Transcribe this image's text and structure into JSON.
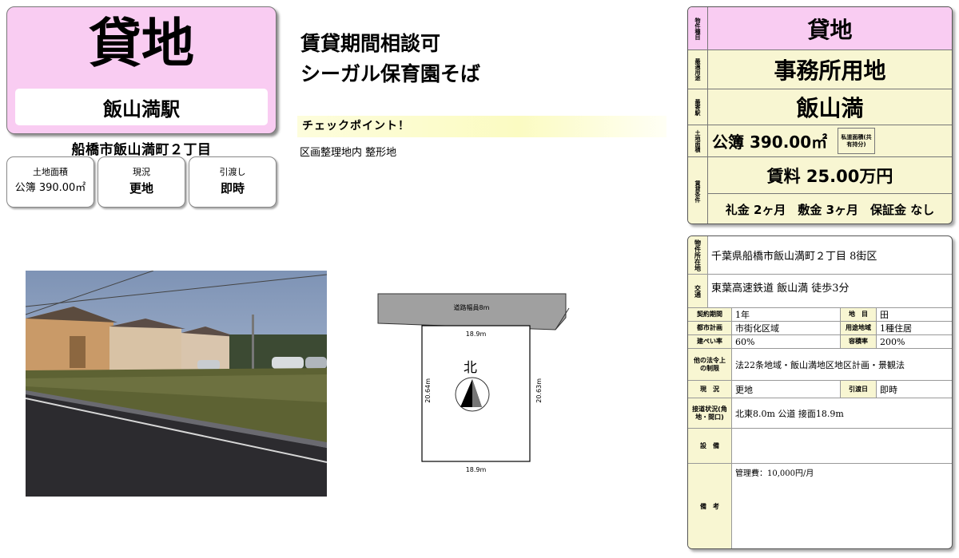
{
  "header": {
    "title": "貸地",
    "station": "飯山満駅",
    "address": "船橋市飯山満町２丁目"
  },
  "info_boxes": [
    {
      "label": "土地面積",
      "value": "公簿 390.00㎡"
    },
    {
      "label": "現況",
      "value": "更地"
    },
    {
      "label": "引渡し",
      "value": "即時"
    }
  ],
  "catchcopy": {
    "line1": "賃貸期間相談可",
    "line2": "シーガル保育園そば"
  },
  "checkpoint": {
    "heading": "チェックポイント！",
    "text": "区画整理地内 整形地"
  },
  "plan": {
    "road_label": "道路幅員8m",
    "top_width": "18.9m",
    "bottom_width": "18.9m",
    "left_depth": "20.64m",
    "right_depth": "20.63m",
    "north_label": "北"
  },
  "summary": {
    "type_label": "物件種目",
    "type_value": "貸地",
    "use_label": "最適用途",
    "use_value": "事務所用地",
    "station_label": "最寄駅",
    "station_value": "飯山満",
    "area_label": "土地面積",
    "area_value": "公簿 390.00㎡",
    "private_road_label": "私道面積(共有持分)",
    "rent_label": "賃貸条件",
    "rent_value": "賃料 25.00万円",
    "conditions": "礼金 2ヶ月　敷金 3ヶ月　保証金 なし"
  },
  "detail": {
    "location_label": "物件所在地",
    "location_value": "千葉県船橋市飯山満町２丁目 8街区",
    "traffic_label": "交通",
    "traffic_value": "東葉高速鉄道 飯山満 徒歩3分",
    "contract_label": "契約期間",
    "contract_value": "1年",
    "land_category_label": "地　目",
    "land_category_value": "田",
    "city_plan_label": "都市計画",
    "city_plan_value": "市街化区域",
    "zoning_label": "用途地域",
    "zoning_value": "1種住居",
    "bcr_label": "建ぺい率",
    "bcr_value": "60%",
    "far_label": "容積率",
    "far_value": "200%",
    "restrictions_label": "他の法令上の制限",
    "restrictions_value": "法22条地域・飯山満地区地区計画・景観法",
    "status_label": "現　況",
    "status_value": "更地",
    "handover_label": "引渡日",
    "handover_value": "即時",
    "road_label": "接道状況(角地・間口)",
    "road_value": "北東8.0m 公道 接面18.9m",
    "facilities_label": "設　備",
    "facilities_value": "",
    "remarks_label": "備　考",
    "remarks_value": "管理費：10,000円/月"
  }
}
